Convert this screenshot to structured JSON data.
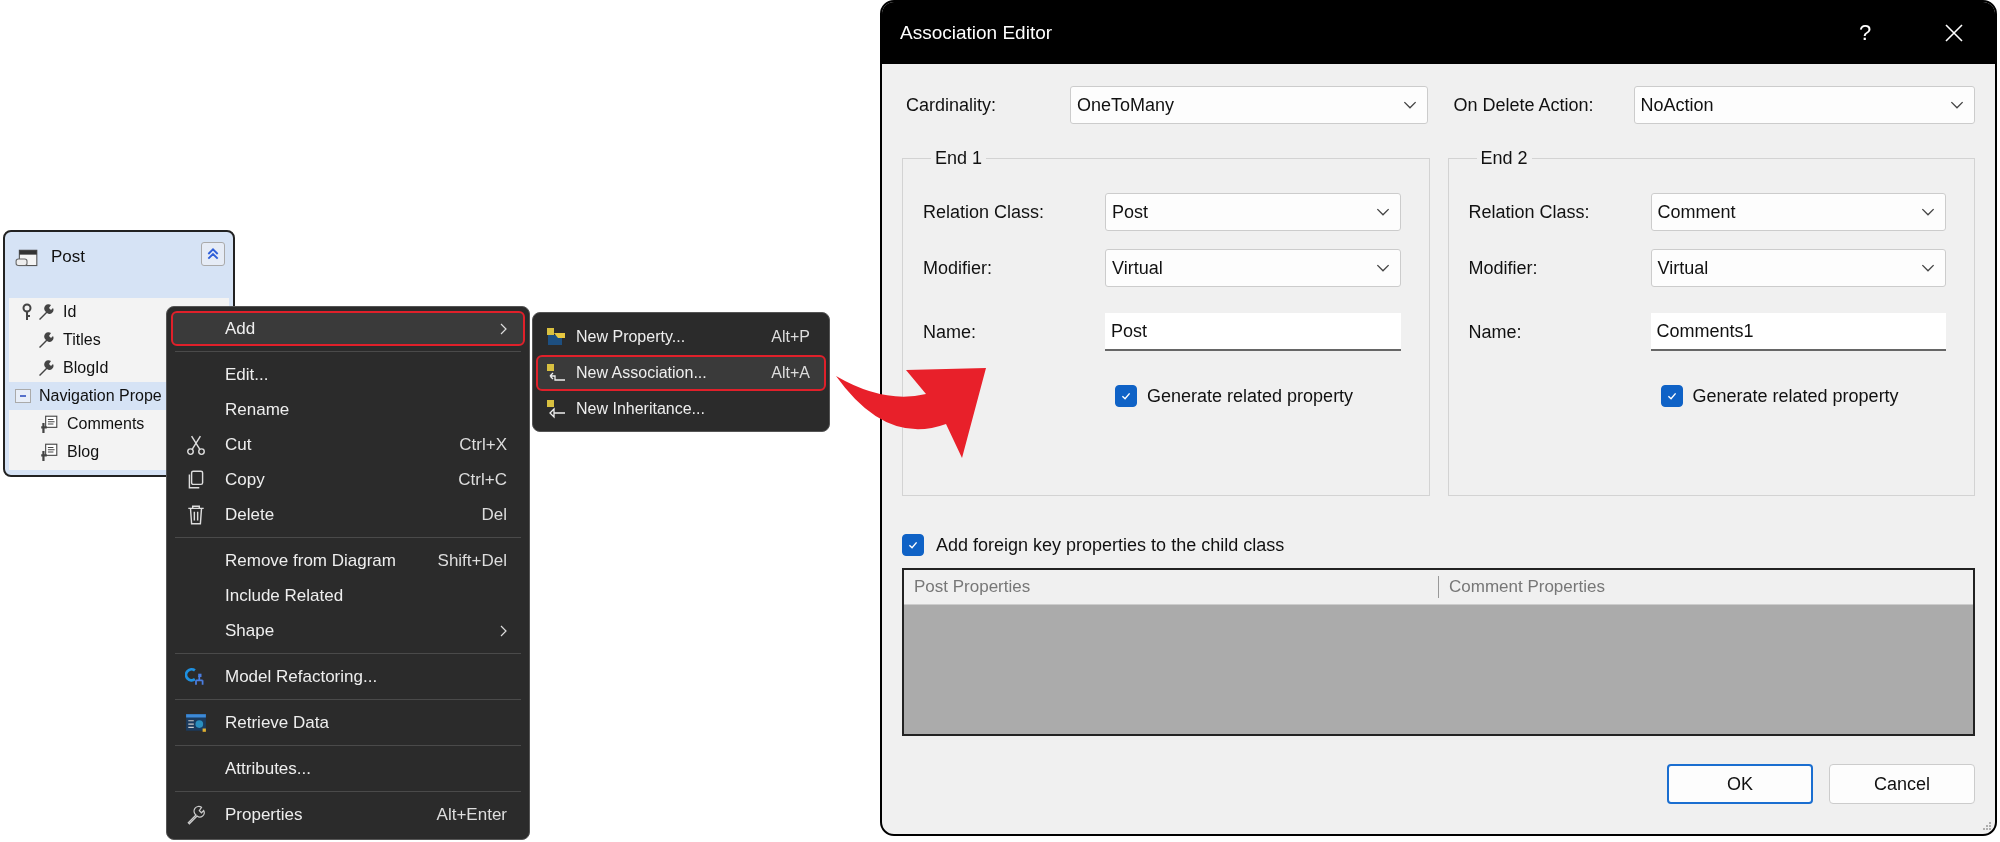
{
  "entity": {
    "title": "Post",
    "properties": [
      {
        "name": "Id",
        "kind": "key"
      },
      {
        "name": "Titles",
        "kind": "property"
      },
      {
        "name": "BlogId",
        "kind": "property"
      }
    ],
    "navigation": {
      "title": "Navigation Prope",
      "expanded": true,
      "items": [
        {
          "name": "Comments"
        },
        {
          "name": "Blog"
        }
      ]
    }
  },
  "context_menu": {
    "groups": [
      [
        {
          "label": "Add",
          "kind": "plain",
          "submenu": true,
          "selected": true
        }
      ],
      [
        {
          "label": "Edit...",
          "kind": "plain",
          "submenu": false,
          "selected": false
        },
        {
          "label": "Rename",
          "kind": "plain",
          "submenu": false,
          "selected": false
        },
        {
          "label": "Cut",
          "shortcut": "Ctrl+X",
          "kind": "cut",
          "submenu": false,
          "selected": false
        },
        {
          "label": "Copy",
          "shortcut": "Ctrl+C",
          "kind": "copy",
          "submenu": false,
          "selected": false
        },
        {
          "label": "Delete",
          "shortcut": "Del",
          "kind": "delete",
          "submenu": false,
          "selected": false
        }
      ],
      [
        {
          "label": "Remove from Diagram",
          "shortcut": "Shift+Del",
          "kind": "plain",
          "submenu": false,
          "selected": false
        },
        {
          "label": "Include Related",
          "kind": "plain",
          "submenu": false,
          "selected": false
        },
        {
          "label": "Shape",
          "kind": "plain",
          "submenu": true,
          "selected": false
        }
      ],
      [
        {
          "label": "Model Refactoring...",
          "kind": "refactor",
          "submenu": false,
          "selected": false
        }
      ],
      [
        {
          "label": "Retrieve Data",
          "kind": "data",
          "submenu": false,
          "selected": false
        }
      ],
      [
        {
          "label": "Attributes...",
          "kind": "plain",
          "submenu": false,
          "selected": false
        }
      ],
      [
        {
          "label": "Properties",
          "shortcut": "Alt+Enter",
          "kind": "wrench",
          "submenu": false,
          "selected": false
        }
      ]
    ]
  },
  "submenu": {
    "items": [
      {
        "label": "New Property...",
        "shortcut": "Alt+P",
        "kind": "property",
        "selected": false
      },
      {
        "label": "New Association...",
        "shortcut": "Alt+A",
        "kind": "association",
        "selected": true
      },
      {
        "label": "New Inheritance...",
        "kind": "inheritance",
        "selected": false
      }
    ]
  },
  "dialog": {
    "title": "Association Editor",
    "help": "?",
    "cardinality": {
      "label": "Cardinality:",
      "value": "OneToMany"
    },
    "on_delete": {
      "label": "On Delete Action:",
      "value": "NoAction"
    },
    "ends": [
      {
        "title": "End 1",
        "relation_class": {
          "label": "Relation Class:",
          "value": "Post"
        },
        "modifier": {
          "label": "Modifier:",
          "value": "Virtual"
        },
        "name": {
          "label": "Name:",
          "value": "Post"
        },
        "generate": {
          "label": "Generate related property",
          "checked": true
        }
      },
      {
        "title": "End 2",
        "relation_class": {
          "label": "Relation Class:",
          "value": "Comment"
        },
        "modifier": {
          "label": "Modifier:",
          "value": "Virtual"
        },
        "name": {
          "label": "Name:",
          "value": "Comments1"
        },
        "generate": {
          "label": "Generate related property",
          "checked": true
        }
      }
    ],
    "foreign_key": {
      "label": "Add foreign key properties to the child class",
      "checked": true
    },
    "table": {
      "columns": [
        "Post Properties",
        "Comment Properties"
      ]
    },
    "buttons": [
      {
        "label": "OK",
        "default": true
      },
      {
        "label": "Cancel",
        "default": false
      }
    ]
  }
}
